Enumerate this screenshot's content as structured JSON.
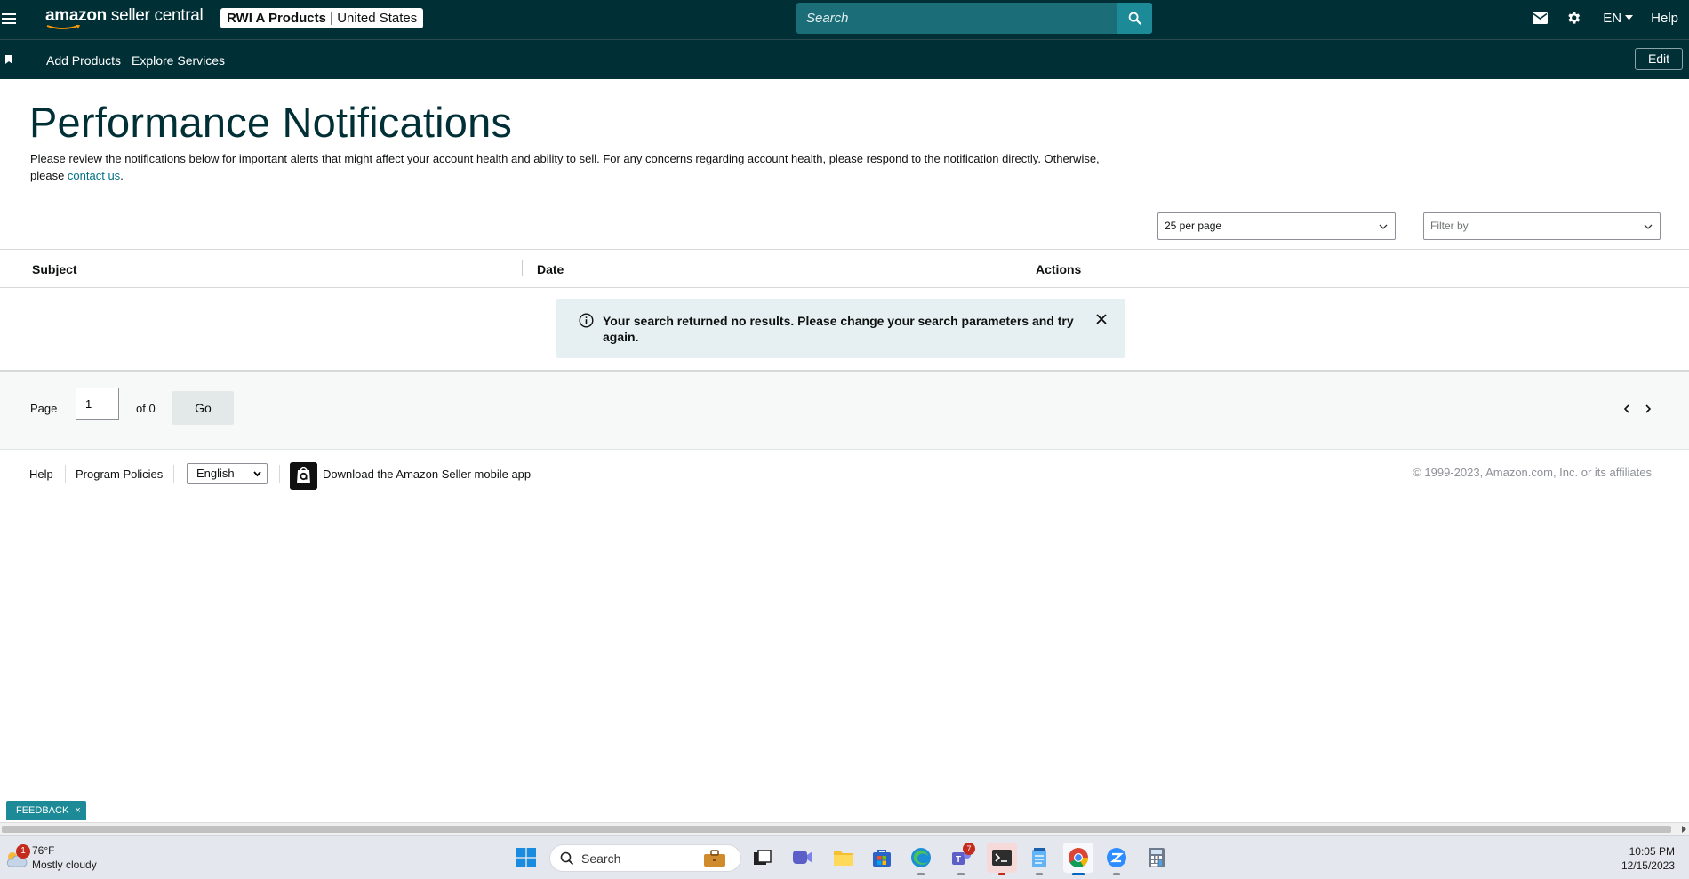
{
  "topbar": {
    "logo_brand": "amazon",
    "logo_suffix": " seller central",
    "account_name": "RWI A Products",
    "account_sep": " | ",
    "account_region": "United States",
    "search_placeholder": "Search",
    "lang_label": "EN",
    "help_label": "Help",
    "colors": {
      "bar": "#002f36",
      "search": "#1b6d77",
      "search_button": "#1c8a97"
    }
  },
  "subnav": {
    "links": [
      "Add Products",
      "Explore Services"
    ],
    "edit_label": "Edit"
  },
  "main": {
    "title": "Performance Notifications",
    "intro_text": "Please review the notifications below for important alerts that might affect your account health and ability to sell. For any concerns regarding account health, please respond to the notification directly. Otherwise, please ",
    "intro_link": "contact us",
    "intro_end": ".",
    "per_page_value": "25 per page",
    "filter_placeholder": "Filter by",
    "columns": [
      "Subject",
      "Date",
      "Actions"
    ],
    "alert_message": "Your search returned no results. Please change your search parameters and try again."
  },
  "pager": {
    "page_label": "Page",
    "page_value": "1",
    "of_label": "of 0",
    "go_label": "Go"
  },
  "footer": {
    "help": "Help",
    "program_policies": "Program Policies",
    "language_value": "English",
    "app_text": "Download the Amazon Seller mobile app",
    "copyright": "© 1999-2023, Amazon.com, Inc. or its affiliates"
  },
  "feedback": {
    "label": "FEEDBACK",
    "close": "×"
  },
  "taskbar": {
    "weather_badge": "1",
    "temperature": "76°F",
    "condition": "Mostly cloudy",
    "search_label": "Search",
    "teams_badge": "7",
    "time": "10:05 PM",
    "date": "12/15/2023",
    "icons": [
      "windows-start-icon",
      "file-explorer-icon",
      "meet-icon",
      "folder-icon",
      "store-icon",
      "edge-icon",
      "teams-icon",
      "terminal-icon",
      "notepad-icon",
      "chrome-icon",
      "zoom-icon",
      "calculator-icon"
    ]
  }
}
